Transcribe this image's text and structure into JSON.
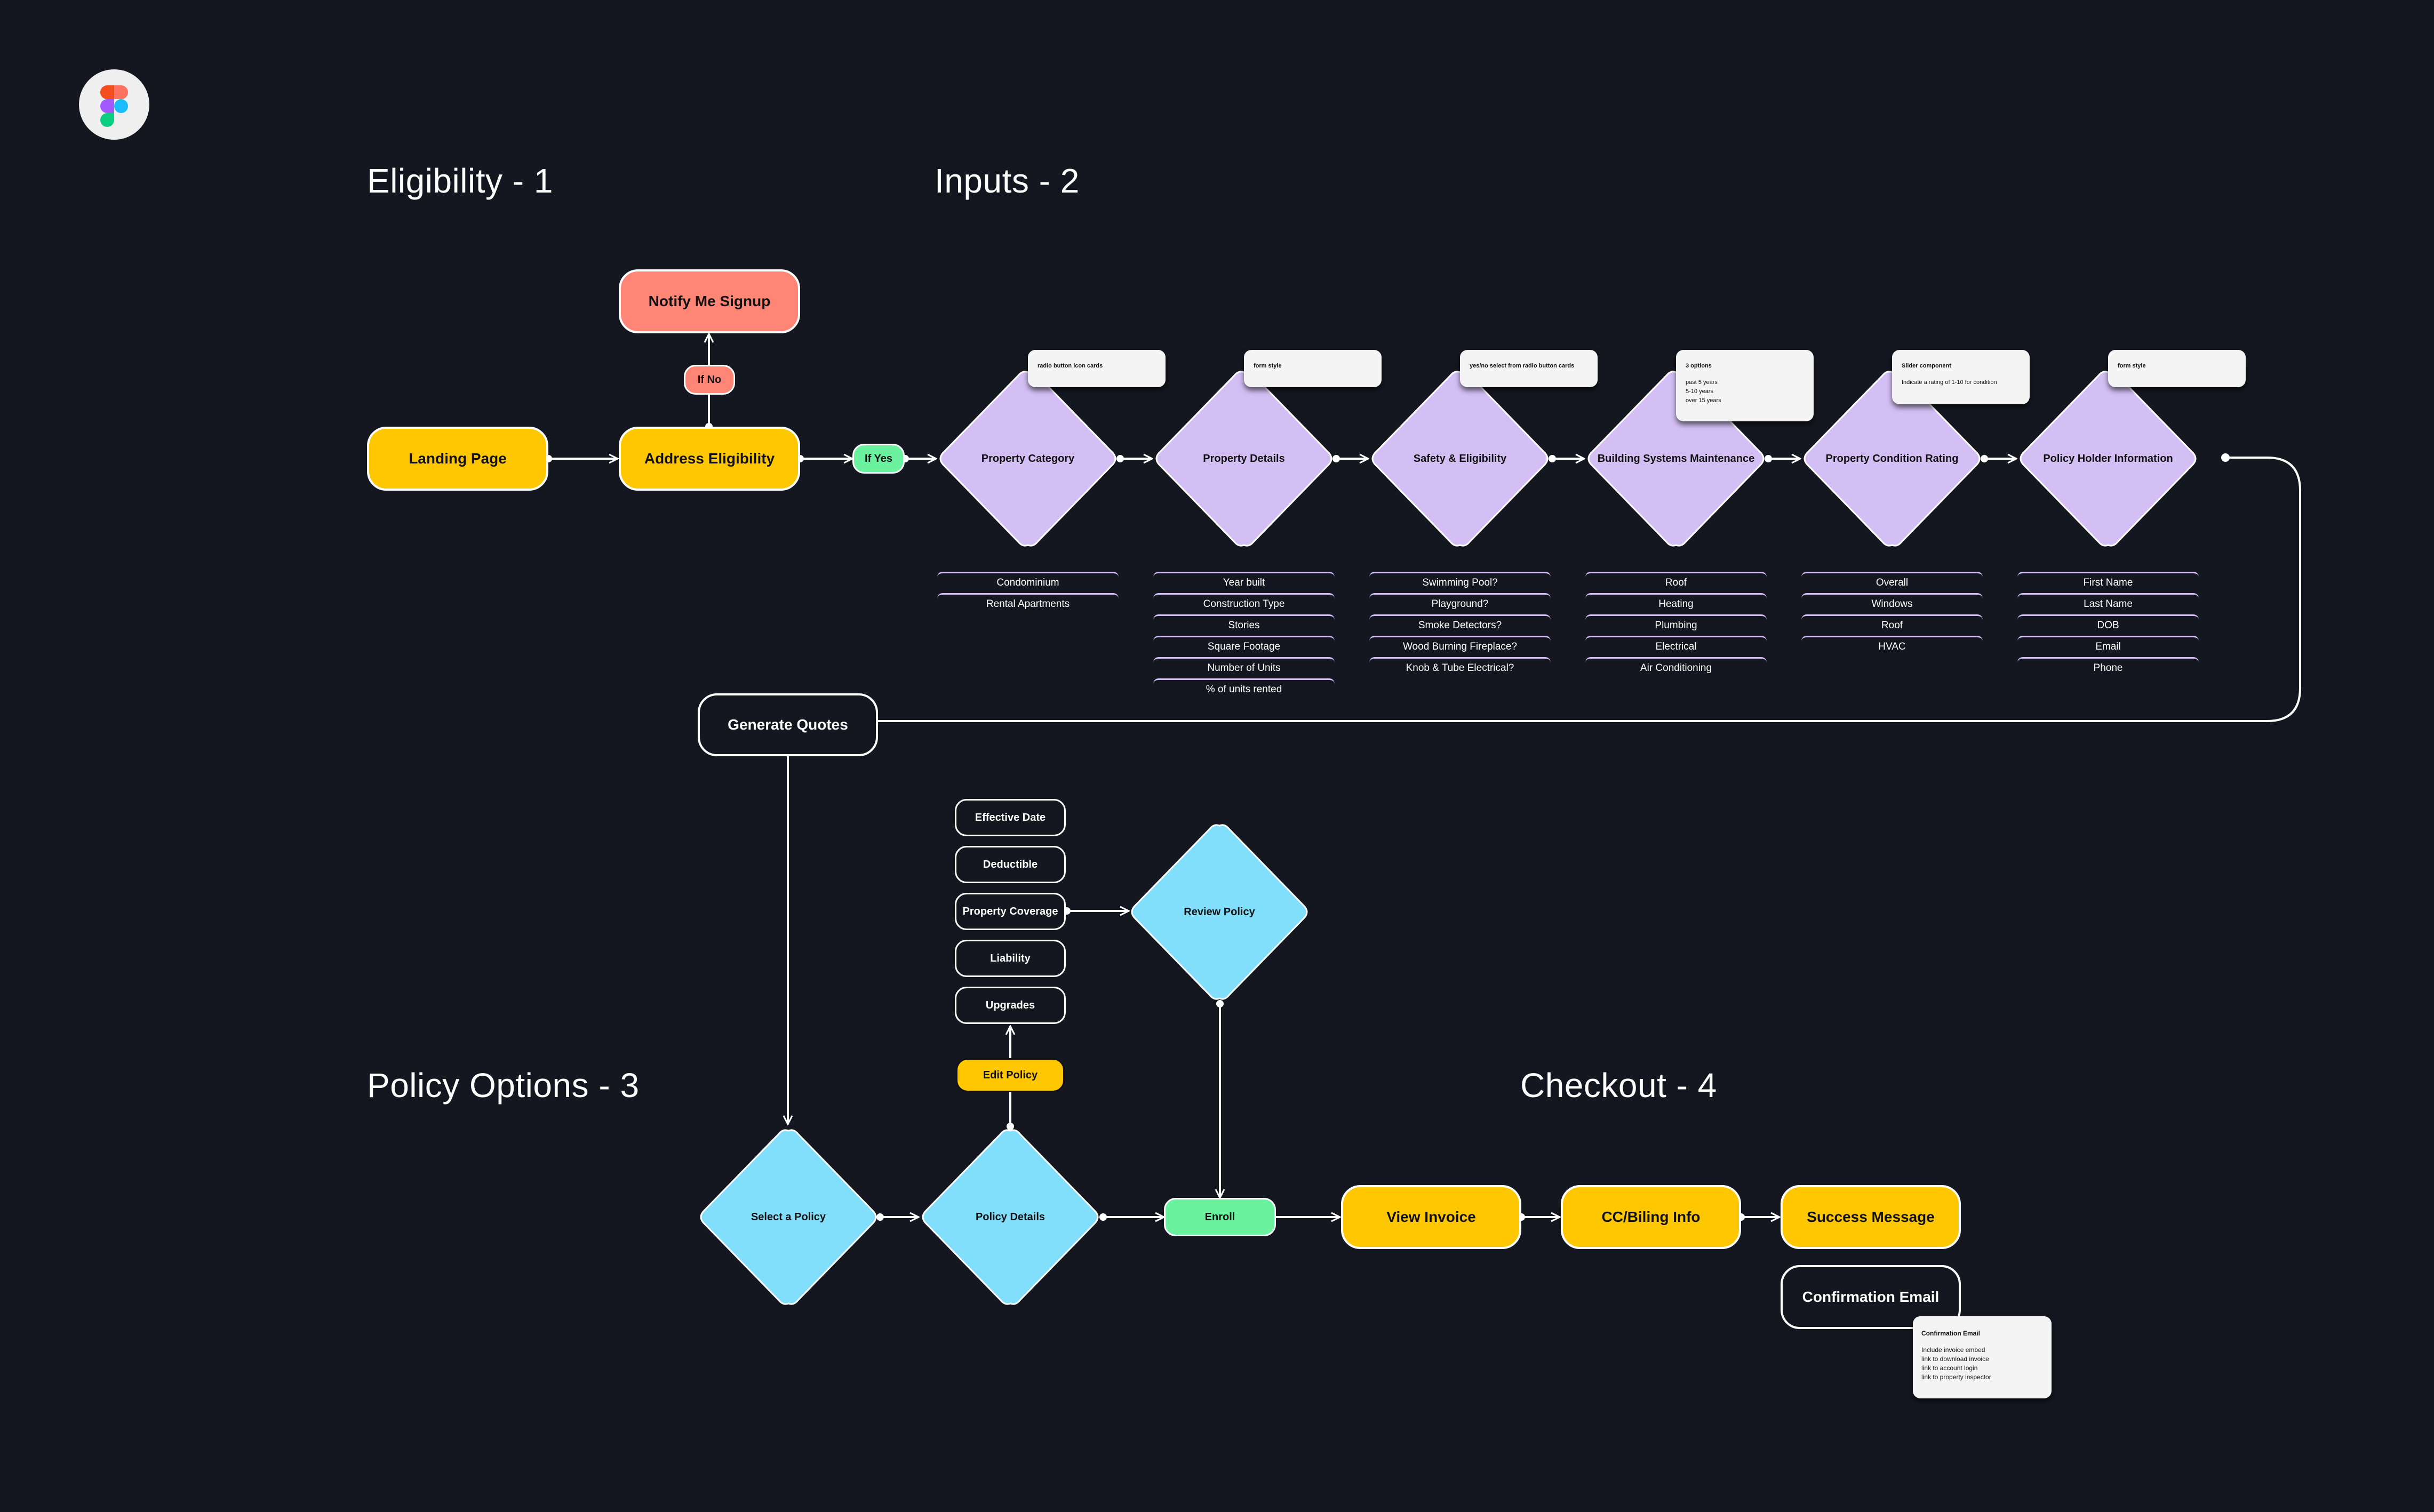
{
  "app": {
    "logo": "figma-logo-icon"
  },
  "sections": {
    "eligibility": "Eligibility - 1",
    "inputs": "Inputs - 2",
    "policy_options": "Policy Options - 3",
    "checkout": "Checkout - 4"
  },
  "eligibility": {
    "landing_page": "Landing Page",
    "address_eligibility": "Address Eligibility",
    "notify_me_signup": "Notify Me Signup",
    "if_no": "If No",
    "if_yes": "If Yes"
  },
  "inputs": {
    "steps": [
      {
        "label": "Property Category",
        "note_title": "radio button icon cards",
        "note_lines": [],
        "items": [
          "Condominium",
          "Rental Apartments"
        ]
      },
      {
        "label": "Property Details",
        "note_title": "form style",
        "note_lines": [],
        "items": [
          "Year built",
          "Construction Type",
          "Stories",
          "Square Footage",
          "Number of Units",
          "% of units rented"
        ]
      },
      {
        "label": "Safety & Eligibility",
        "note_title": "yes/no select from radio button cards",
        "note_lines": [],
        "items": [
          "Swimming Pool?",
          "Playground?",
          "Smoke Detectors?",
          "Wood Burning Fireplace?",
          "Knob & Tube Electrical?"
        ]
      },
      {
        "label": "Building Systems Maintenance",
        "note_title": "3 options",
        "note_lines": [
          "past 5 years",
          "5-10 years",
          "over 15 years"
        ],
        "items": [
          "Roof",
          "Heating",
          "Plumbing",
          "Electrical",
          "Air Conditioning"
        ]
      },
      {
        "label": "Property Condition Rating",
        "note_title": "Slider component",
        "note_lines": [
          "Indicate a rating of 1-10 for condition"
        ],
        "items": [
          "Overall",
          "Windows",
          "Roof",
          "HVAC"
        ]
      },
      {
        "label": "Policy Holder Information",
        "note_title": "form style",
        "note_lines": [],
        "items": [
          "First Name",
          "Last Name",
          "DOB",
          "Email",
          "Phone"
        ]
      }
    ],
    "generate_quotes": "Generate Quotes"
  },
  "policy": {
    "select_policy": "Select a Policy",
    "policy_details": "Policy Details",
    "edit_policy": "Edit Policy",
    "review_policy": "Review Policy",
    "enroll": "Enroll",
    "options": [
      "Effective Date",
      "Deductible",
      "Property Coverage",
      "Liability",
      "Upgrades"
    ]
  },
  "checkout": {
    "view_invoice": "View Invoice",
    "cc_billing": "CC/Biling Info",
    "success_message": "Success Message",
    "confirmation_email": "Confirmation Email",
    "note_title": "Confirmation Email",
    "note_lines": [
      "Include invoice embed",
      "link to download invoice",
      "link to account login",
      "link to property inspector"
    ]
  },
  "colors": {
    "background": "#141720",
    "yellow": "#ffc700",
    "salmon": "#ff8577",
    "green": "#6bf29f",
    "lavender": "#d4bff5",
    "sky": "#82dffc"
  }
}
